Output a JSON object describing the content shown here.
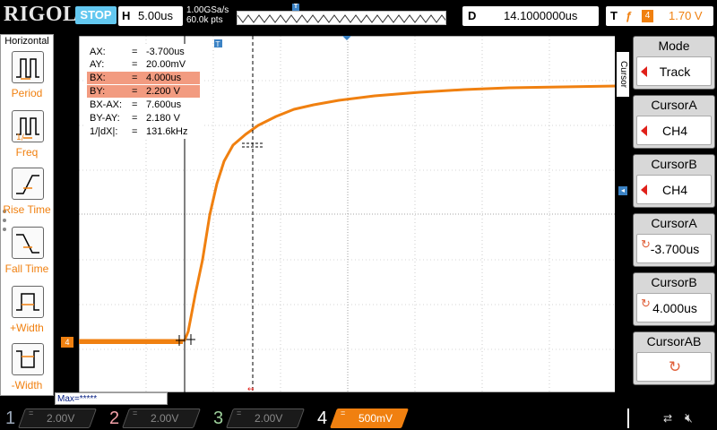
{
  "header": {
    "brand": "RIGOL",
    "run_status": "STOP",
    "timebase_letter": "H",
    "timebase": "5.00us",
    "sample_rate": "1.00GSa/s",
    "mem_depth": "60.0k pts",
    "trig_marker": "T",
    "delay_letter": "D",
    "delay": "14.1000000us",
    "trigger_letter": "T",
    "trigger_slope": "ƒ",
    "trigger_channel": "4",
    "trigger_level": "1.70 V"
  },
  "left_menu": {
    "title": "Horizontal",
    "items": [
      {
        "label": "Period",
        "icon": "period-icon"
      },
      {
        "label": "Freq",
        "icon": "frequency-icon"
      },
      {
        "label": "Rise Time",
        "icon": "rise-time-icon"
      },
      {
        "label": "Fall Time",
        "icon": "fall-time-icon"
      },
      {
        "label": "+Width",
        "icon": "positive-width-icon"
      },
      {
        "label": "-Width",
        "icon": "negative-width-icon"
      }
    ]
  },
  "cursor_readout": {
    "eq": "=",
    "rows": [
      {
        "key": "AX:",
        "value": "-3.700us",
        "highlight": false
      },
      {
        "key": "AY:",
        "value": "20.00mV",
        "highlight": false
      },
      {
        "key": "BX:",
        "value": "4.000us",
        "highlight": true
      },
      {
        "key": "BY:",
        "value": "2.200 V",
        "highlight": true
      },
      {
        "key": "BX-AX:",
        "value": "7.600us",
        "highlight": false
      },
      {
        "key": "BY-AY:",
        "value": "2.180 V",
        "highlight": false
      },
      {
        "key": "1/|dX|:",
        "value": "131.6kHz",
        "highlight": false
      }
    ]
  },
  "max_bar": "Max=*****",
  "right_menu": {
    "tab": "Cursor",
    "items": [
      {
        "title": "Mode",
        "value": "Track",
        "kind": "arrow"
      },
      {
        "title": "CursorA",
        "value": "CH4",
        "kind": "arrow"
      },
      {
        "title": "CursorB",
        "value": "CH4",
        "kind": "arrow"
      },
      {
        "title": "CursorA",
        "value": "-3.700us",
        "kind": "knob"
      },
      {
        "title": "CursorB",
        "value": "4.000us",
        "kind": "knob"
      },
      {
        "title": "CursorAB",
        "value": "",
        "kind": "knob-big"
      }
    ]
  },
  "channel_marker": "4",
  "channels": [
    {
      "num": "1",
      "coupling": "=",
      "scale": "2.00V",
      "color": "#9aa7b8",
      "active": false
    },
    {
      "num": "2",
      "coupling": "=",
      "scale": "2.00V",
      "color": "#f2a0a8",
      "active": false
    },
    {
      "num": "3",
      "coupling": "=",
      "scale": "2.00V",
      "color": "#9ccf9a",
      "active": false
    },
    {
      "num": "4",
      "coupling": "=",
      "scale": "500mV",
      "color": "#f08010",
      "active": true
    }
  ],
  "colors": {
    "trace": "#f08010",
    "stop": "#63c8f0",
    "marker": "#3b82c4"
  }
}
